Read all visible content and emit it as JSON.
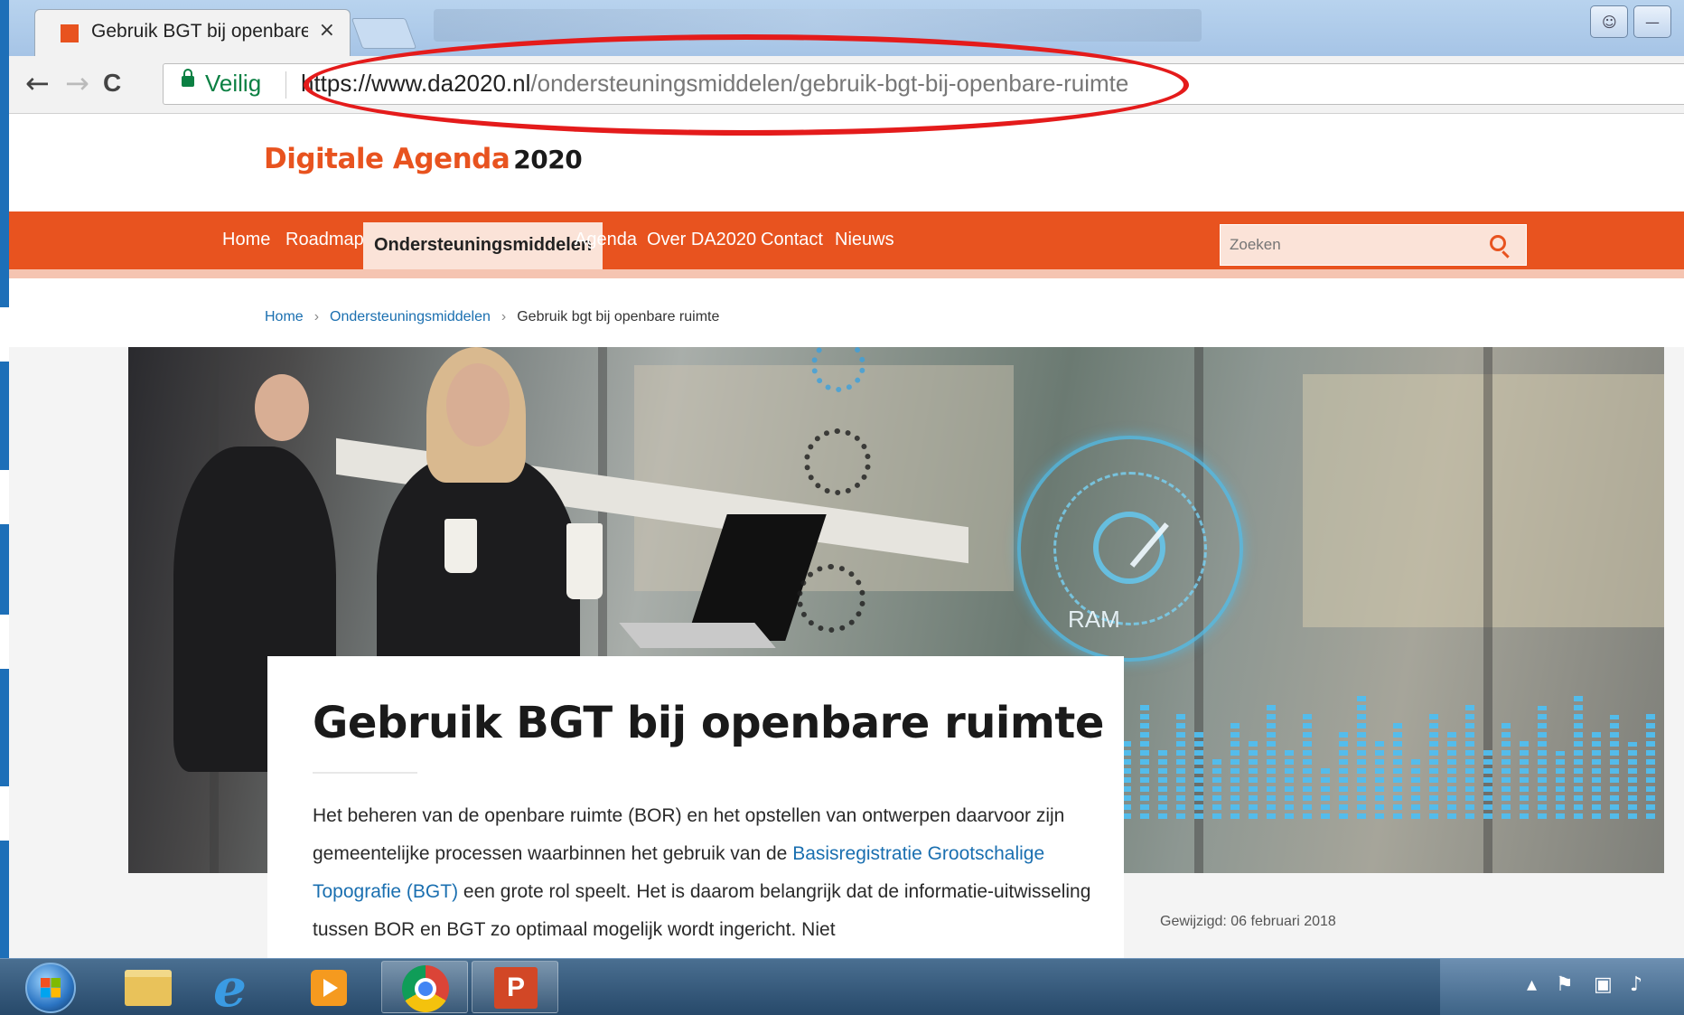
{
  "browser": {
    "tab": {
      "title": "Gebruik BGT bij openbare ruimte",
      "close_label": "×"
    },
    "nav": {
      "back": "←",
      "forward": "→",
      "reload": "C"
    },
    "address": {
      "security_label": "Veilig",
      "url_host": "https://www.da2020.nl",
      "url_path": "/ondersteuningsmiddelen/gebruik-bgt-bij-openbare-ruimte"
    },
    "annotation_color": "#e41b1b"
  },
  "site": {
    "logo": {
      "name": "Digitale Agenda",
      "year": "2020"
    },
    "brand_color": "#e8531f",
    "nav": {
      "items": [
        "Home",
        "Roadmap",
        "Ondersteuningsmiddelen",
        "Agenda",
        "Over DA2020",
        "Contact",
        "Nieuws"
      ],
      "active": "Ondersteuningsmiddelen"
    },
    "search": {
      "placeholder": "Zoeken"
    },
    "breadcrumb": {
      "items": [
        "Home",
        "Ondersteuningsmiddelen"
      ],
      "separator": "›",
      "current": "Gebruik bgt bij openbare ruimte"
    }
  },
  "hero": {
    "gauge_label": "RAM"
  },
  "article": {
    "title": "Gebruik BGT bij openbare ruimte",
    "body_before_link": "Het beheren van de openbare ruimte (BOR) en het opstellen van ontwerpen daarvoor zijn gemeentelijke processen waarbinnen het gebruik van de ",
    "link_text": "Basisregistratie Grootschalige Topografie (BGT)",
    "body_after_link": " een grote rol speelt. Het is daarom belangrijk dat de informatie-uitwisseling tussen BOR en BGT zo optimaal mogelijk wordt ingericht. Niet",
    "modified_label": "Gewijzigd:",
    "modified_date": "06 februari 2018"
  },
  "taskbar": {
    "items": [
      "windows-explorer-icon",
      "internet-explorer-icon",
      "media-player-icon",
      "chrome-icon",
      "powerpoint-icon"
    ],
    "tray_icons": [
      "show-hidden-icons-arrow",
      "action-center-icon",
      "network-icon",
      "volume-icon"
    ]
  }
}
